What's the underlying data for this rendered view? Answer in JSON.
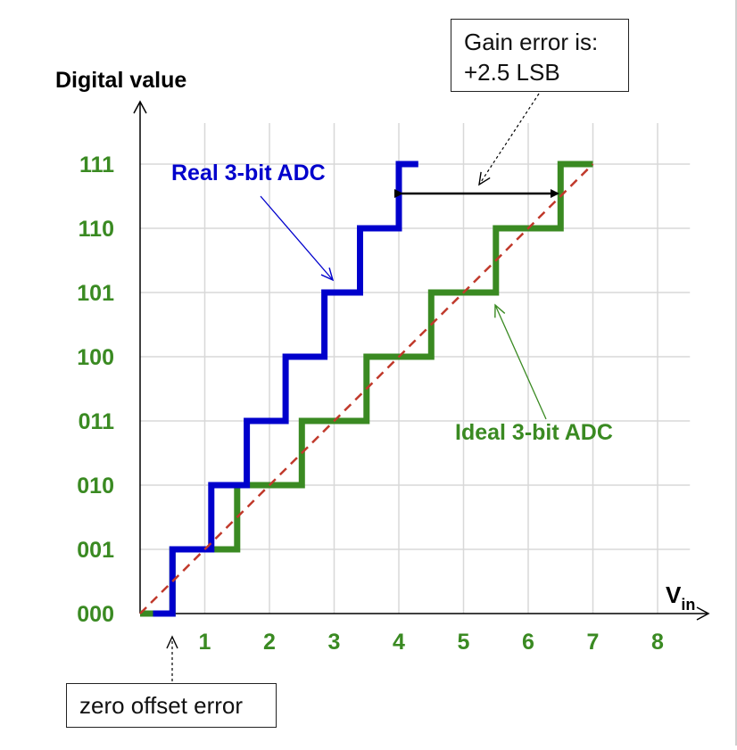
{
  "chart_data": {
    "type": "line",
    "ylabel": "Digital value",
    "xlabel": "V",
    "xlabel_sub": "in",
    "x_ticks": [
      "1",
      "2",
      "3",
      "4",
      "5",
      "6",
      "7",
      "8"
    ],
    "y_ticks": [
      "000",
      "001",
      "010",
      "011",
      "100",
      "101",
      "110",
      "111"
    ],
    "xlim": [
      0,
      8.5
    ],
    "ylim": [
      0,
      7.5
    ],
    "grid": true,
    "series": [
      {
        "name": "Real 3-bit ADC",
        "color": "#0000cc",
        "points": [
          [
            0.2,
            0
          ],
          [
            0.5,
            0
          ],
          [
            0.5,
            1
          ],
          [
            1.1,
            1
          ],
          [
            1.1,
            2
          ],
          [
            1.65,
            2
          ],
          [
            1.65,
            3
          ],
          [
            2.25,
            3
          ],
          [
            2.25,
            4
          ],
          [
            2.85,
            4
          ],
          [
            2.85,
            5
          ],
          [
            3.4,
            5
          ],
          [
            3.4,
            6
          ],
          [
            4.0,
            6
          ],
          [
            4.0,
            7
          ],
          [
            4.3,
            7
          ]
        ]
      },
      {
        "name": "Ideal 3-bit ADC",
        "color": "#3a8a22",
        "points": [
          [
            0.0,
            0
          ],
          [
            0.5,
            0
          ],
          [
            0.5,
            1
          ],
          [
            1.5,
            1
          ],
          [
            1.5,
            2
          ],
          [
            2.5,
            2
          ],
          [
            2.5,
            3
          ],
          [
            3.5,
            3
          ],
          [
            3.5,
            4
          ],
          [
            4.5,
            4
          ],
          [
            4.5,
            5
          ],
          [
            5.5,
            5
          ],
          [
            5.5,
            6
          ],
          [
            6.5,
            6
          ],
          [
            6.5,
            7
          ],
          [
            7.0,
            7
          ]
        ]
      },
      {
        "name": "",
        "color": "#c0392b",
        "dashed": true,
        "points": [
          [
            0.0,
            0
          ],
          [
            7.0,
            7
          ]
        ]
      }
    ],
    "annotations": {
      "real_label": "Real 3-bit ADC",
      "ideal_label": "Ideal 3-bit ADC",
      "gain_line1": "Gain error is:",
      "gain_line2": "+2.5 LSB",
      "offset_label": "zero offset error"
    },
    "colors": {
      "axis": "#000000",
      "grid": "#d8d8d8",
      "tick_label": "#3a8a22",
      "real": "#0000cc",
      "ideal": "#3a8a22"
    }
  }
}
